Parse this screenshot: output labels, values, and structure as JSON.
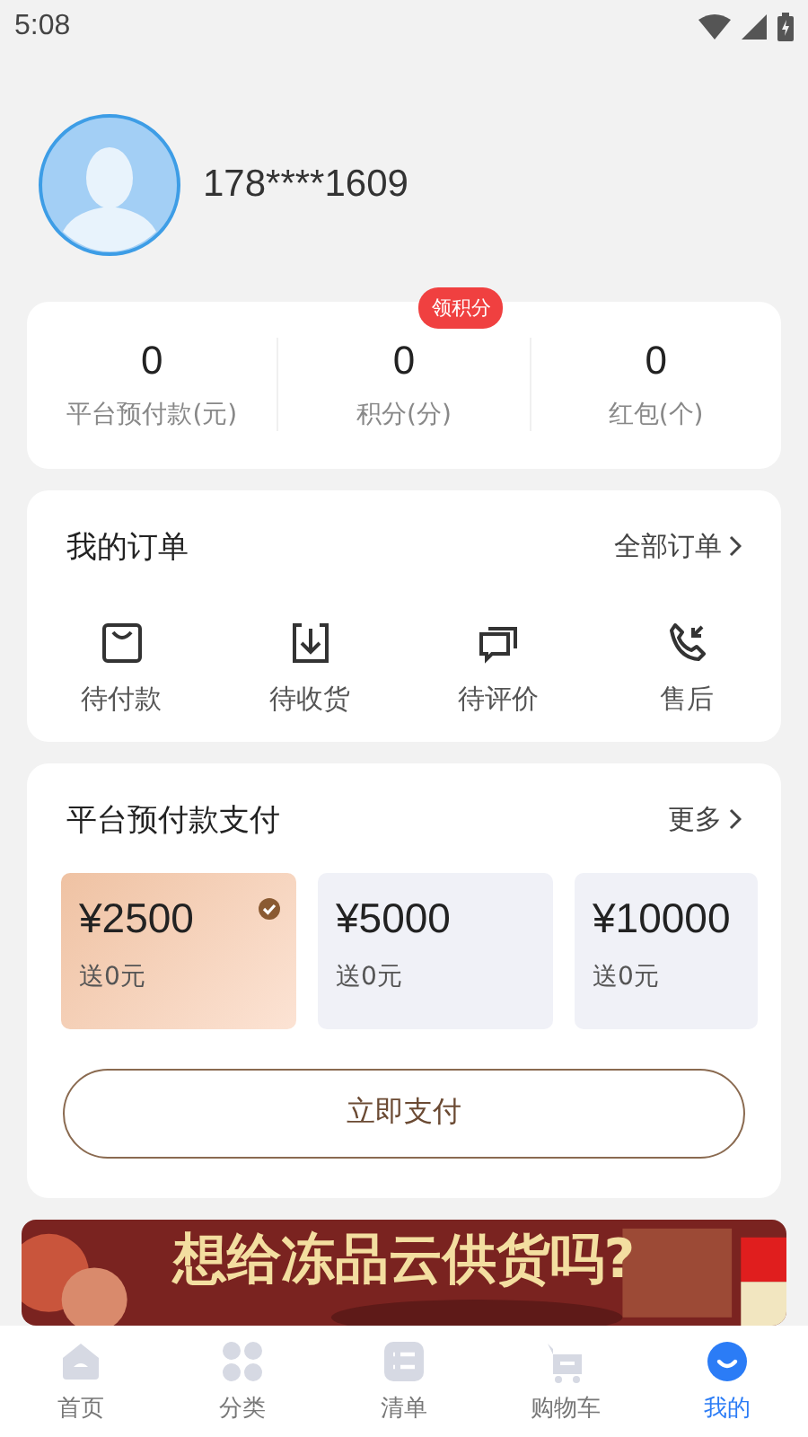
{
  "status_bar": {
    "time": "5:08"
  },
  "profile": {
    "phone": "178****1609"
  },
  "stats": [
    {
      "value": "0",
      "label": "平台预付款(元)"
    },
    {
      "value": "0",
      "label": "积分(分)",
      "badge": "领积分"
    },
    {
      "value": "0",
      "label": "红包(个)"
    }
  ],
  "orders": {
    "title": "我的订单",
    "link": "全部订单",
    "items": [
      {
        "kind": "bag",
        "label": "待付款"
      },
      {
        "kind": "receive",
        "label": "待收货"
      },
      {
        "kind": "comment",
        "label": "待评价"
      },
      {
        "kind": "phone",
        "label": "售后"
      }
    ]
  },
  "prepay": {
    "title": "平台预付款支付",
    "link": "更多",
    "options": [
      {
        "amount": "¥2500",
        "bonus": "送0元",
        "selected": true
      },
      {
        "amount": "¥5000",
        "bonus": "送0元",
        "selected": false
      },
      {
        "amount": "¥10000",
        "bonus": "送0元",
        "selected": false
      }
    ],
    "button": "立即支付"
  },
  "banner": {
    "title": "想给冻品云供货吗?"
  },
  "tabs": [
    {
      "kind": "home",
      "label": "首页",
      "selected": false
    },
    {
      "kind": "category",
      "label": "分类",
      "selected": false
    },
    {
      "kind": "list",
      "label": "清单",
      "selected": false
    },
    {
      "kind": "cart",
      "label": "购物车",
      "selected": false
    },
    {
      "kind": "me",
      "label": "我的",
      "selected": true
    }
  ]
}
